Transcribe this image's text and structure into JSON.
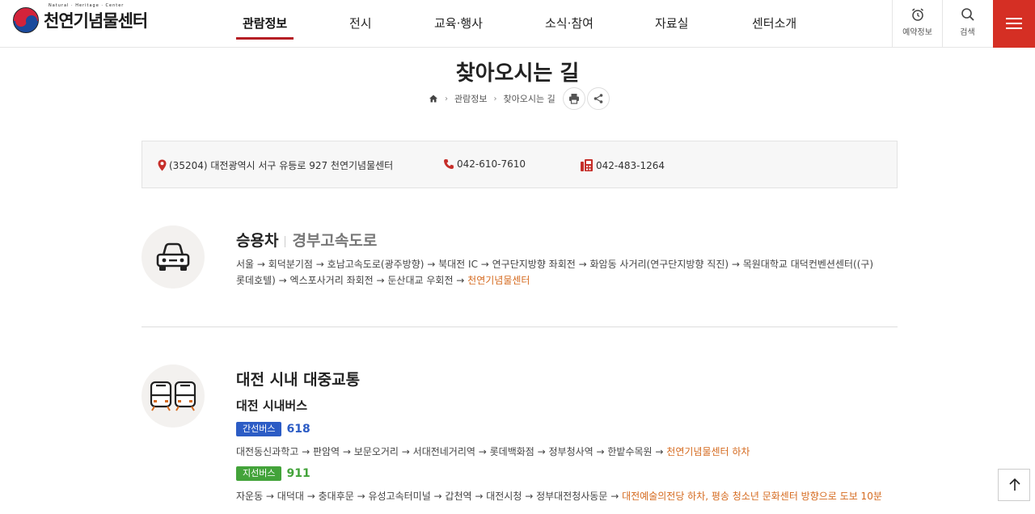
{
  "header": {
    "logo_text": "천연기념물센터",
    "logo_sub": "Natural · Heritage · Center",
    "nav": [
      {
        "label": "관람정보"
      },
      {
        "label": "전시"
      },
      {
        "label": "교육·행사"
      },
      {
        "label": "소식·참여"
      },
      {
        "label": "자료실"
      },
      {
        "label": "센터소개"
      }
    ],
    "util": {
      "reservation": "예약정보",
      "search": "검색"
    }
  },
  "page": {
    "title": "찾아오시는 길",
    "breadcrumb": [
      "관람정보",
      "찾아오시는 길"
    ]
  },
  "info": {
    "address": "(35204) 대전광역시 서구 유등로 927 천연기념물센터",
    "phone": "042-610-7610",
    "fax": "042-483-1264"
  },
  "car": {
    "title": "승용차",
    "subtitle": "경부고속도로",
    "route_line1": "서울 → 회덕분기점 → 호남고속도로(광주방향) → 북대전 IC → 연구단지방향 좌회전 → 화암동 사거리(연구단지방향 직진) → 목원대학교 대덕컨벤션센터((구)",
    "route_line2": "롯데호텔) → 엑스포사거리 좌회전 → 둔산대교 우회전 → ",
    "route_dest": "천연기념물센터"
  },
  "transit": {
    "title": "대전 시내 대중교통",
    "subtitle": "대전 시내버스",
    "buses": [
      {
        "type": "간선버스",
        "number": "618",
        "route": "대전동신과학고 → 판암역 → 보문오거리 → 서대전네거리역 → 롯데백화점 → 정부청사역 → 한밭수목원 → ",
        "dest": "천연기념물센터 하차"
      },
      {
        "type": "지선버스",
        "number": "911",
        "route": "자운동 → 대덕대 → 충대후문 → 유성고속터미널 → 갑천역 → 대전시청 → 정부대전청사동문 → ",
        "dest": "대전예술의전당 하차, 평송 청소년 문화센터 방향으로 도보 10분"
      }
    ]
  },
  "colors": {
    "brand_red": "#d52f24",
    "active_underline": "#b51e24",
    "highlight_orange": "#d56a1f",
    "trunk_blue": "#2c5cc5",
    "branch_green": "#43a33a"
  }
}
